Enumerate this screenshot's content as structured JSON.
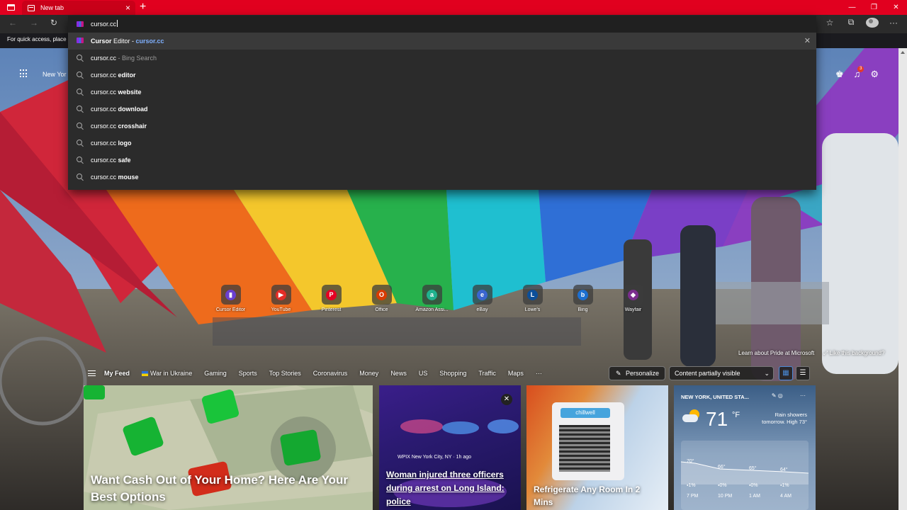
{
  "window": {
    "tab_title": "New tab",
    "close_glyph": "×",
    "new_tab_glyph": "+",
    "min_glyph": "—",
    "max_glyph": "❐",
    "win_close_glyph": "✕"
  },
  "toolbar": {
    "back_glyph": "←",
    "forward_glyph": "→",
    "reload_glyph": "↻",
    "fav_glyph": "☆",
    "collections_glyph": "⧉",
    "more_glyph": "···"
  },
  "address": {
    "value": "cursor.cc"
  },
  "suggestions": [
    {
      "bold": "Cursor",
      "rest": " Editor - ",
      "url": "cursor.cc",
      "type": "site"
    },
    {
      "prefix": "cursor.cc",
      "bold": "",
      "dim": " - Bing Search"
    },
    {
      "prefix": "cursor.cc ",
      "bold": "editor"
    },
    {
      "prefix": "cursor.cc ",
      "bold": "website"
    },
    {
      "prefix": "cursor.cc ",
      "bold": "download"
    },
    {
      "prefix": "cursor.cc ",
      "bold": "crosshair"
    },
    {
      "prefix": "cursor.cc ",
      "bold": "logo"
    },
    {
      "prefix": "cursor.cc ",
      "bold": "safe"
    },
    {
      "prefix": "cursor.cc ",
      "bold": "mouse"
    }
  ],
  "favorites_hint": "For quick access, place y",
  "ntp": {
    "city": "New Yor",
    "notif_count": "3",
    "learn_text": "Learn about Pride at Microsoft",
    "like_text": "Like this background?",
    "quick_links": [
      {
        "label": "Cursor Editor",
        "glyph": "▮",
        "color": "#6a3fd0"
      },
      {
        "label": "YouTube",
        "glyph": "▶",
        "color": "#e52d27"
      },
      {
        "label": "Pinterest",
        "glyph": "P",
        "color": "#e60023"
      },
      {
        "label": "Office",
        "glyph": "O",
        "color": "#d83b01"
      },
      {
        "label": "Amazon Assi...",
        "glyph": "a",
        "color": "#20b28e"
      },
      {
        "label": "eBay",
        "glyph": "e",
        "color": "#3a66d0"
      },
      {
        "label": "Lowe's",
        "glyph": "L",
        "color": "#0d4f99"
      },
      {
        "label": "Bing",
        "glyph": "b",
        "color": "#1c6fd1"
      },
      {
        "label": "Wayfair",
        "glyph": "◆",
        "color": "#7b2d8e"
      }
    ]
  },
  "feed": {
    "items": [
      "My Feed",
      "War in Ukraine",
      "Gaming",
      "Sports",
      "Top Stories",
      "Coronavirus",
      "Money",
      "News",
      "US",
      "Shopping",
      "Traffic",
      "Maps",
      "···"
    ],
    "personalize": "Personalize",
    "content_filter": "Content partially visible"
  },
  "cards": {
    "card1_title": "Want Cash Out of Your Home? Here Are Your Best Options",
    "card2_source": "WPIX New York City, NY · 1h ago",
    "card2_title": "Woman injured three officers during arrest on Long Island: police",
    "card3_brand": "chillwell",
    "card3_title": "Refrigerate Any Room In 2 Mins"
  },
  "weather": {
    "location": "NEW YORK, UNITED STA...",
    "temp": "71",
    "unit": "°F",
    "desc_line1": "Rain showers",
    "desc_line2": "tomorrow. High 73°",
    "hourly": [
      {
        "temp": "70°",
        "precip": "1%",
        "time": "7 PM"
      },
      {
        "temp": "66°",
        "precip": "0%",
        "time": "10 PM"
      },
      {
        "temp": "65°",
        "precip": "0%",
        "time": "1 AM"
      },
      {
        "temp": "64°",
        "precip": "1%",
        "time": "4 AM"
      }
    ]
  },
  "colors": {
    "titlebar": "#e1001f",
    "omnibox": "#2b2b2b",
    "link": "#7fb0ff"
  }
}
